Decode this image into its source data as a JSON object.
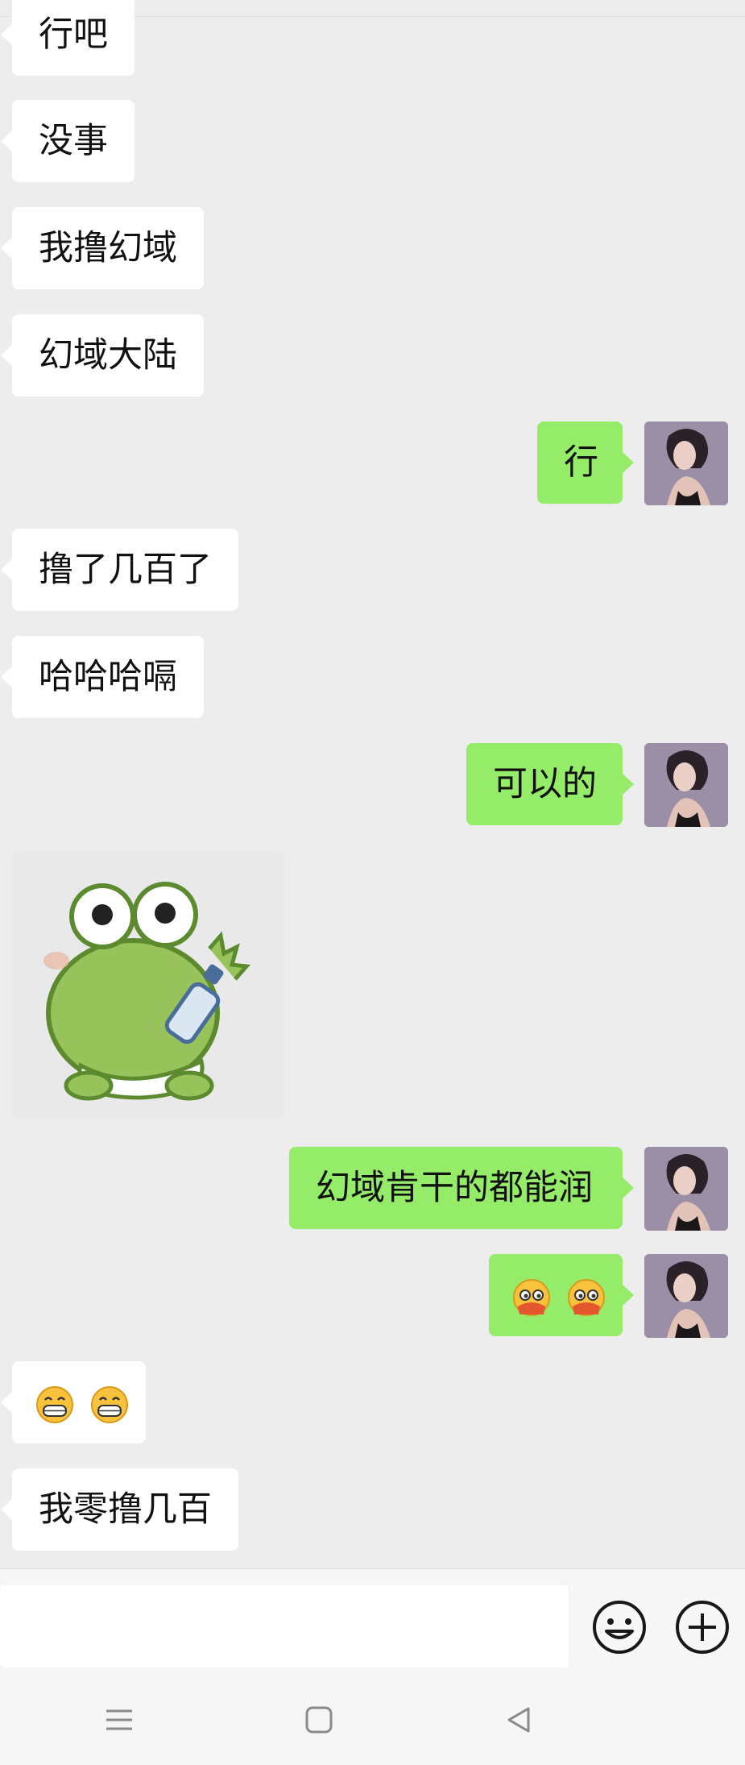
{
  "messages": [
    {
      "side": "in",
      "text": "行吧"
    },
    {
      "side": "in",
      "text": "没事"
    },
    {
      "side": "in",
      "text": "我撸幻域"
    },
    {
      "side": "in",
      "text": "幻域大陆"
    },
    {
      "side": "out",
      "text": "行"
    },
    {
      "side": "in",
      "text": "撸了几百了"
    },
    {
      "side": "in",
      "text": "哈哈哈嗝"
    },
    {
      "side": "out",
      "text": "可以的"
    },
    {
      "side": "in",
      "sticker": "frog-sticker"
    },
    {
      "side": "out",
      "text": "幻域肯干的都能润"
    },
    {
      "side": "out",
      "emoji": "peeking-emoji x2"
    },
    {
      "side": "in",
      "emoji": "grin-emoji x2"
    },
    {
      "side": "in",
      "text": "我零撸几百"
    }
  ],
  "input": {
    "placeholder": ""
  },
  "icons": {
    "emoji_button": "smiley-icon",
    "more_button": "plus-circle-icon",
    "nav_menu": "menu-icon",
    "nav_home": "square-home-icon",
    "nav_back": "triangle-back-icon"
  },
  "colors": {
    "background": "#ededed",
    "outgoing": "#95ec69",
    "incoming": "#ffffff"
  }
}
